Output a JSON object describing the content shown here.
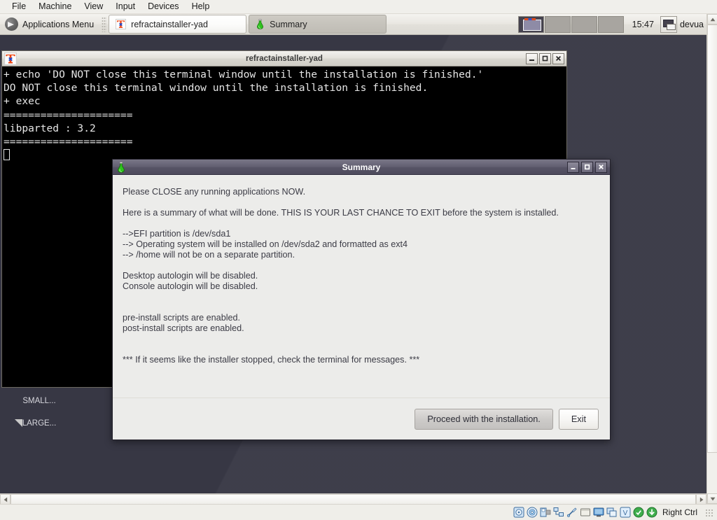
{
  "host": {
    "menubar": [
      "File",
      "Machine",
      "View",
      "Input",
      "Devices",
      "Help"
    ],
    "statusbar": {
      "host_key_label": "Right Ctrl",
      "icons": [
        "hard-disk-icon",
        "optical-disk-icon",
        "floppy-disk-icon",
        "network-icon",
        "usb-icon",
        "shared-folder-icon",
        "display-icon",
        "recording-icon",
        "virtualization-icon",
        "mouse-integration-icon",
        "keyboard-capture-icon"
      ]
    }
  },
  "panel": {
    "applications_menu_label": "Applications Menu",
    "applications_menu_icon": "mouse-logo-icon",
    "tasks": [
      {
        "label": "refractainstaller-yad",
        "icon": "xterm-icon",
        "active": true
      },
      {
        "label": "Summary",
        "icon": "green-flask-icon",
        "active": false
      }
    ],
    "pager": {
      "workspaces": 4,
      "active_index": 0,
      "icon": "workspace-switcher-icon"
    },
    "clock": "15:47",
    "tray_icon": "display-settings-icon",
    "username": "devua"
  },
  "desktop": {
    "icons": [
      {
        "label": "SMALL...",
        "icon": "text-file-icon"
      },
      {
        "label": "LARGE...",
        "icon": "text-file-icon"
      }
    ]
  },
  "terminal": {
    "title": "refractainstaller-yad",
    "title_icon": "xterm-icon",
    "window_buttons": [
      "minimize",
      "maximize",
      "close"
    ],
    "lines": [
      "+ echo 'DO NOT close this terminal window until the installation is finished.'",
      "DO NOT close this terminal window until the installation is finished.",
      "+ exec",
      "=====================",
      "libparted : 3.2",
      "====================="
    ]
  },
  "dialog": {
    "title": "Summary",
    "title_icon": "green-flask-icon",
    "window_buttons": [
      "minimize",
      "maximize",
      "close"
    ],
    "body_text": "Please CLOSE any running applications NOW.\n\nHere is a summary of what will be done. THIS IS YOUR LAST CHANCE TO EXIT before the system is installed.\n\n-->EFI partition is /dev/sda1\n--> Operating system will be installed on /dev/sda2 and formatted as ext4\n--> /home will not be on a separate partition.\n\nDesktop autologin will be disabled.\nConsole autologin will be disabled.\n\n\npre-install scripts are enabled.\npost-install scripts are enabled.\n\n\n*** If it seems like the installer stopped, check the terminal for messages. ***",
    "proceed_label": "Proceed with the installation.",
    "exit_label": "Exit"
  },
  "colors": {
    "desktop_bg": "#373744",
    "panel_bg": "#e9e7e2",
    "dialog_title_bg": "#615e70",
    "dialog_body_bg": "#ececea",
    "terminal_bg": "#000000",
    "terminal_fg": "#e6e6e6",
    "flask_green": "#2fc31e"
  }
}
